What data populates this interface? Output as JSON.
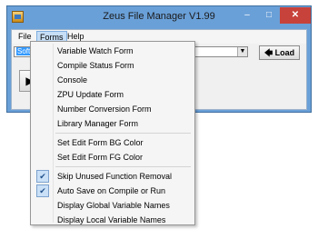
{
  "window": {
    "title": "Zeus File Manager V1.99",
    "controls": {
      "minimize": "–",
      "maximize": "□",
      "close": "✕"
    }
  },
  "menubar": {
    "file": "File",
    "forms": "Forms",
    "help": "Help"
  },
  "combo": {
    "value": "Softpe",
    "arrow": "▼"
  },
  "load_button": {
    "icon": "🡄",
    "label": "Load"
  },
  "play_button": {
    "icon": "▶"
  },
  "forms_menu": {
    "items": [
      "Variable Watch Form",
      "Compile Status Form",
      "Console",
      "ZPU Update Form",
      "Number Conversion Form",
      "Library Manager Form",
      "Set Edit Form BG Color",
      "Set Edit Form FG Color",
      "Skip Unused Function Removal",
      "Auto Save on Compile or Run",
      "Display Global Variable Names",
      "Display Local Variable Names"
    ],
    "check": "✔"
  },
  "colors": {
    "titlebar": "#6aa0d8",
    "close": "#c7423a",
    "menu_highlight": "#c6def6"
  }
}
